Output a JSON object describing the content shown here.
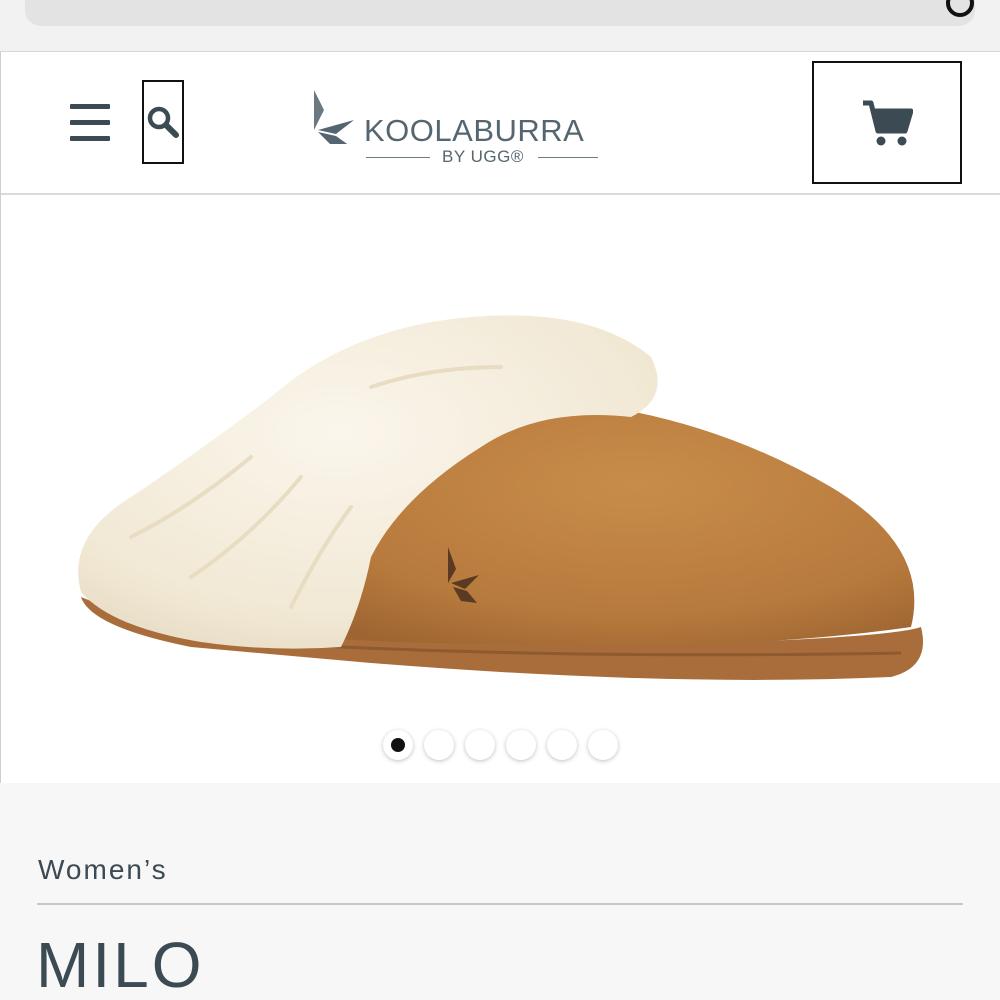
{
  "header": {
    "brand": "KOOLABURRA",
    "brand_sub": "BY UGG®",
    "icons": {
      "menu": "hamburger-menu-icon",
      "search": "search-icon",
      "cart": "shopping-cart-icon",
      "reload": "reload-icon"
    },
    "colors": {
      "icon": "#3c4a54",
      "brand_text": "#566670"
    }
  },
  "product": {
    "category": "Women’s",
    "name": "MILO",
    "image_alt": "",
    "carousel": {
      "total": 6,
      "active_index": 0
    },
    "colors": {
      "suede": "#b97a3e",
      "fur": "#f3ead8",
      "sole": "#a86a3a"
    }
  }
}
